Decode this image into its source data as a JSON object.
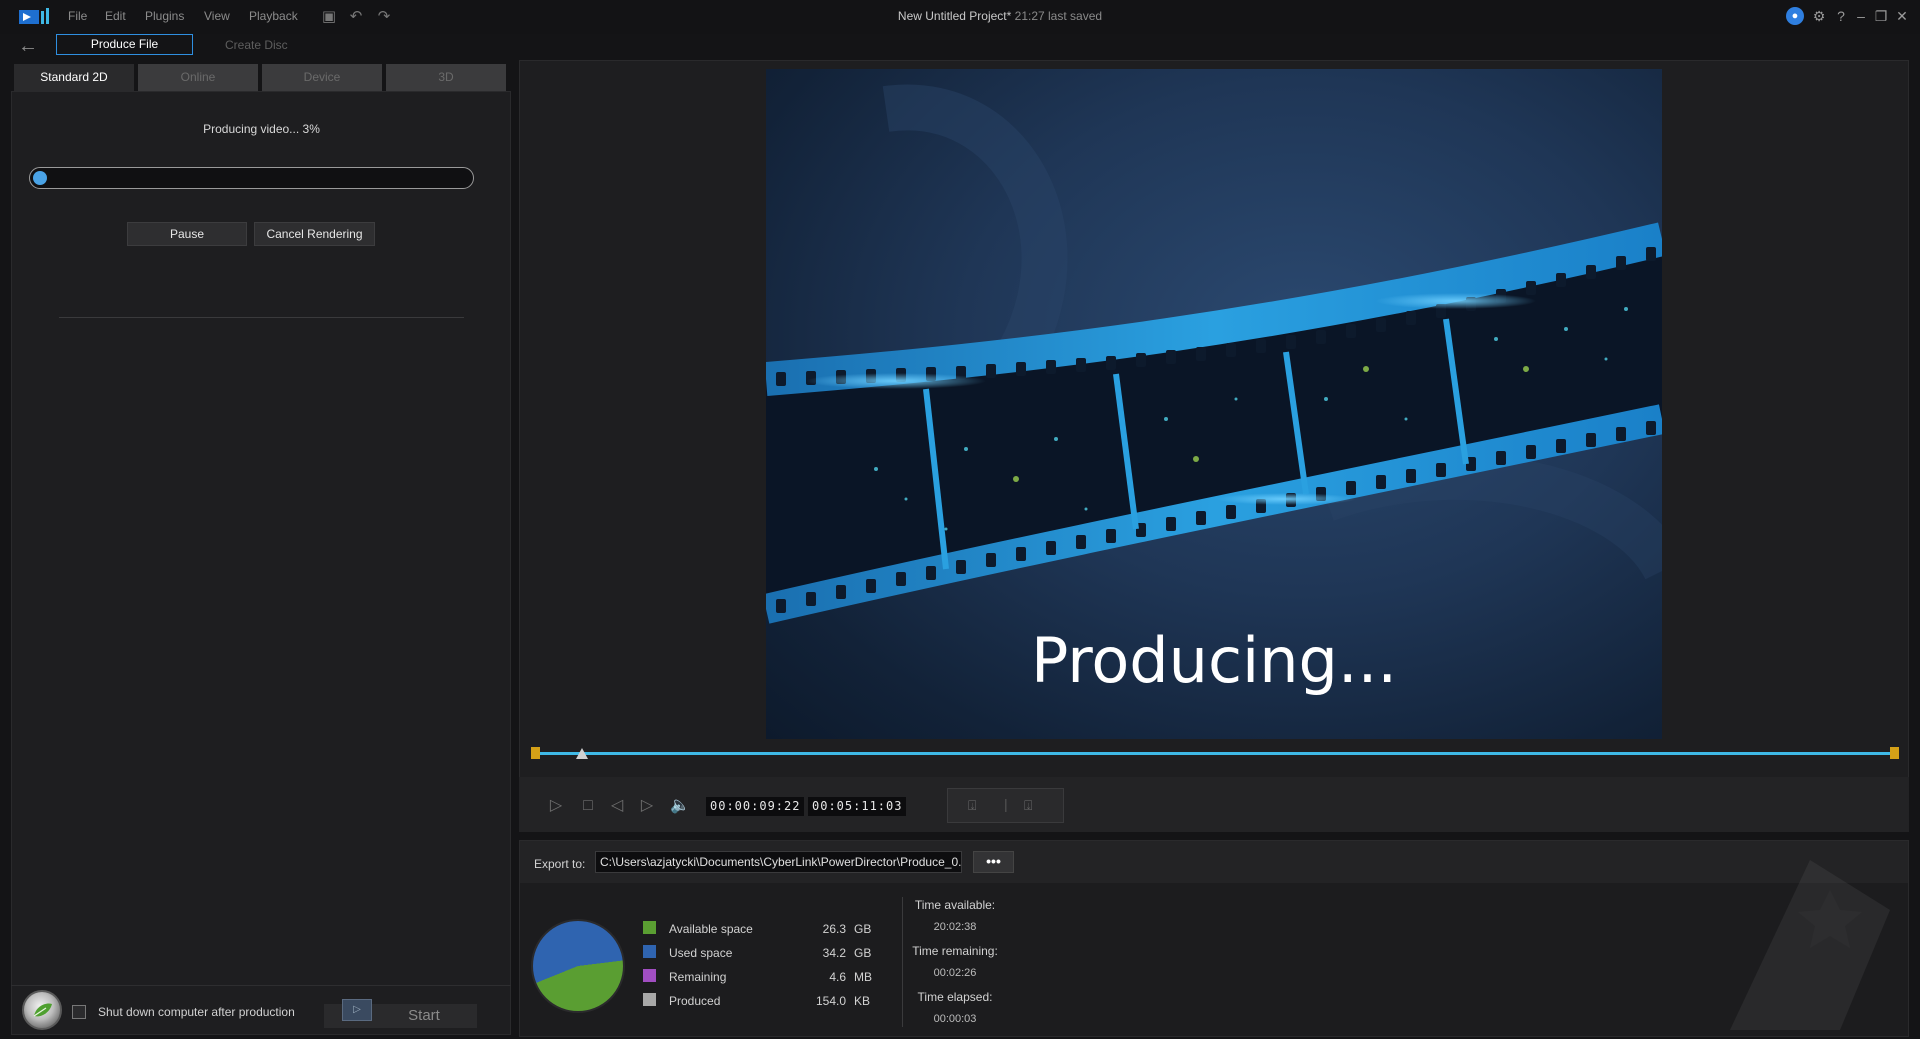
{
  "app": {
    "menu": [
      "File",
      "Edit",
      "Plugins",
      "View",
      "Playback"
    ],
    "project_title": "New Untitled Project*",
    "save_status": "21:27 last saved"
  },
  "mode_tabs": {
    "produce": "Produce File",
    "disc": "Create Disc"
  },
  "format_tabs": [
    "Standard 2D",
    "Online",
    "Device",
    "3D"
  ],
  "production": {
    "status_text": "Producing video... 3%",
    "progress_fraction": 0.03,
    "pause_label": "Pause",
    "cancel_label": "Cancel Rendering",
    "shutdown_label": "Shut down computer after production",
    "start_label": "Start"
  },
  "preview": {
    "overlay_text": "Producing...",
    "current_timecode": "00:00:09:22",
    "total_timecode": "00:05:11:03"
  },
  "export": {
    "label": "Export to:",
    "path": "C:\\Users\\azjatycki\\Documents\\CyberLink\\PowerDirector\\Produce_0...",
    "browse_label": "•••"
  },
  "disk_usage": {
    "colors": {
      "available": "#5a9e32",
      "used": "#2f64b0",
      "remaining": "#a14ec2",
      "produced": "#a8a8a8"
    },
    "legend": [
      {
        "label": "Available space",
        "value": "26.3",
        "unit": "GB"
      },
      {
        "label": "Used space",
        "value": "34.2",
        "unit": "GB"
      },
      {
        "label": "Remaining",
        "value": "4.6",
        "unit": "MB"
      },
      {
        "label": "Produced",
        "value": "154.0",
        "unit": "KB"
      }
    ]
  },
  "timing": {
    "available_label": "Time available:",
    "available_value": "20:02:38",
    "remaining_label": "Time remaining:",
    "remaining_value": "00:02:26",
    "elapsed_label": "Time elapsed:",
    "elapsed_value": "00:00:03"
  }
}
